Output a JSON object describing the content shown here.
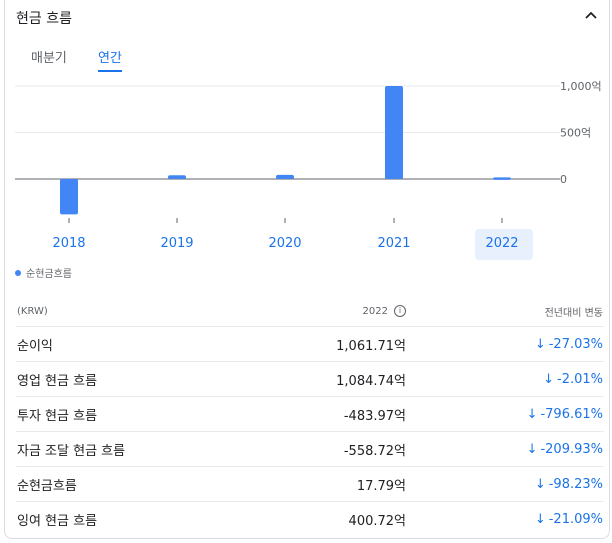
{
  "header": {
    "title": "현금 흐름"
  },
  "tabs": [
    {
      "label": "매분기"
    },
    {
      "label": "연간"
    }
  ],
  "chart_data": {
    "type": "bar",
    "categories": [
      "2018",
      "2019",
      "2020",
      "2021",
      "2022"
    ],
    "series": [
      {
        "name": "순현금흐름",
        "values": [
          -380,
          40,
          45,
          1000,
          17.79
        ]
      }
    ],
    "y_ticks": [
      "1,000억",
      "500억",
      "0"
    ],
    "ylim": [
      -450,
      1000
    ],
    "selected": "2022"
  },
  "legend": {
    "label": "순현금흐름"
  },
  "table": {
    "headers": [
      "(KRW)",
      "2022",
      "전년대비 변동"
    ],
    "rows": [
      {
        "label": "순이익",
        "value": "1,061.71억",
        "change": "-27.03%"
      },
      {
        "label": "영업 현금 흐름",
        "value": "1,084.74억",
        "change": "-2.01%"
      },
      {
        "label": "투자 현금 흐름",
        "value": "-483.97억",
        "change": "-796.61%"
      },
      {
        "label": "자금 조달 현금 흐름",
        "value": "-558.72억",
        "change": "-209.93%"
      },
      {
        "label": "순현금흐름",
        "value": "17.79억",
        "change": "-98.23%"
      },
      {
        "label": "잉여 현금 흐름",
        "value": "400.72억",
        "change": "-21.09%"
      }
    ]
  }
}
